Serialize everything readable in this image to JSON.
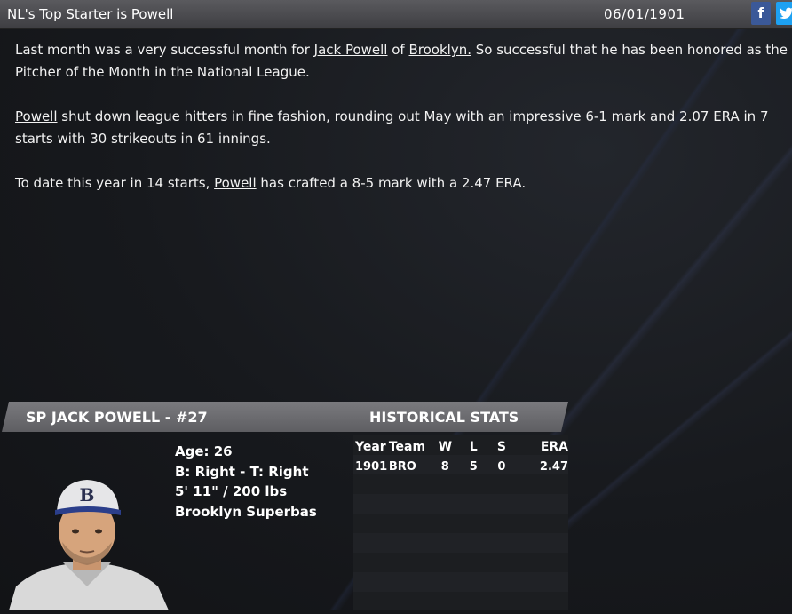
{
  "header": {
    "title": "NL's Top Starter is Powell",
    "date": "06/01/1901",
    "facebook_label": "f",
    "twitter_label": "🐦"
  },
  "article": {
    "p1_a": "Last month was a very successful month for ",
    "p1_link_player": "Jack Powell",
    "p1_b": " of ",
    "p1_link_team": "Brooklyn.",
    "p1_c": " So successful that he has been honored as the Pitcher of the Month in the National League.",
    "p2_link_player": "Powell",
    "p2_a": " shut down league hitters in fine fashion, rounding out May with an impressive 6-1 mark and 2.07 ERA in 7 starts with 30 strikeouts in 61 innings.",
    "p3_a": "To date this year in 14 starts, ",
    "p3_link_player": "Powell",
    "p3_b": " has crafted a 8-5 mark with a 2.47 ERA."
  },
  "player": {
    "banner": "SP JACK POWELL - #27",
    "age": "Age: 26",
    "bats_throws": "B: Right - T: Right",
    "size": "5' 11\" / 200 lbs",
    "team": "Brooklyn Superbas",
    "cap_letter": "B"
  },
  "stats": {
    "heading": "HISTORICAL STATS",
    "columns": [
      "Year",
      "Team",
      "W",
      "L",
      "S",
      "ERA"
    ],
    "rows": [
      [
        "1901",
        "BRO",
        "8",
        "5",
        "0",
        "2.47"
      ]
    ]
  }
}
